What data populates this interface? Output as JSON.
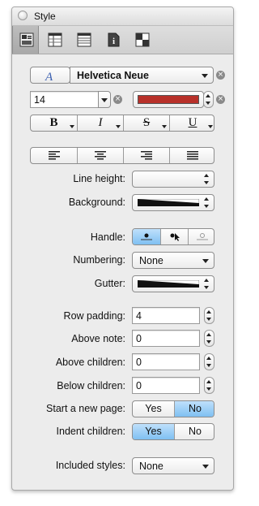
{
  "window": {
    "title": "Style"
  },
  "toolbar": {
    "tabs": [
      {
        "icon": "style-tab-icon",
        "selected": true
      },
      {
        "icon": "columns-tab-icon",
        "selected": false
      },
      {
        "icon": "rows-tab-icon",
        "selected": false
      },
      {
        "icon": "info-tab-icon",
        "selected": false
      },
      {
        "icon": "canvas-tab-icon",
        "selected": false
      }
    ]
  },
  "font": {
    "family": "Helvetica Neue",
    "size": "14",
    "color": "#b8312a",
    "bold_label": "B",
    "italic_label": "I",
    "strike_label": "S",
    "underline_label": "U",
    "clear_symbol": "×"
  },
  "form": {
    "line_height": {
      "label": "Line height:",
      "value": ""
    },
    "background": {
      "label": "Background:"
    },
    "handle": {
      "label": "Handle:"
    },
    "numbering": {
      "label": "Numbering:",
      "value": "None"
    },
    "gutter": {
      "label": "Gutter:"
    },
    "row_padding": {
      "label": "Row padding:",
      "value": "4"
    },
    "above_note": {
      "label": "Above note:",
      "value": "0"
    },
    "above_children": {
      "label": "Above children:",
      "value": "0"
    },
    "below_children": {
      "label": "Below children:",
      "value": "0"
    },
    "start_new_page": {
      "label": "Start a new page:",
      "yes": "Yes",
      "no": "No",
      "selected": "No"
    },
    "indent_children": {
      "label": "Indent children:",
      "yes": "Yes",
      "no": "No",
      "selected": "Yes"
    },
    "included_styles": {
      "label": "Included styles:",
      "value": "None"
    }
  },
  "colors": {
    "selected_segment": "#7fc0f2",
    "panel_bg": "#ececec"
  }
}
